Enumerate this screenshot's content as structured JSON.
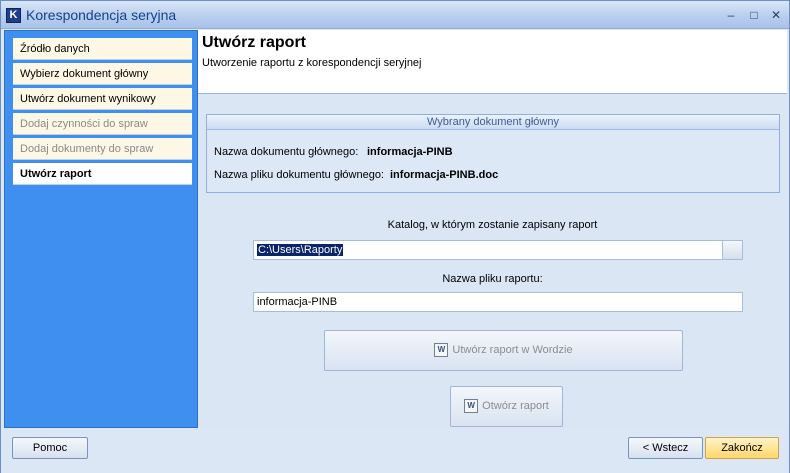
{
  "window": {
    "title": "Korespondencja seryjna",
    "icon_letter": "K",
    "minimize_glyph": "–",
    "maximize_glyph": "□",
    "close_glyph": "✕"
  },
  "sidebar": {
    "items": [
      {
        "label": "Źródło danych",
        "state": "normal"
      },
      {
        "label": "Wybierz dokument główny",
        "state": "normal"
      },
      {
        "label": "Utwórz dokument wynikowy",
        "state": "normal"
      },
      {
        "label": "Dodaj czynności do spraw",
        "state": "disabled"
      },
      {
        "label": "Dodaj dokumenty do spraw",
        "state": "disabled"
      },
      {
        "label": "Utwórz raport",
        "state": "active"
      }
    ]
  },
  "header": {
    "title": "Utwórz raport",
    "subtitle": "Utworzenie raportu z korespondencji seryjnej"
  },
  "group": {
    "title": "Wybrany dokument główny",
    "doc_name_label": "Nazwa dokumentu głównego:",
    "doc_name_value": "informacja-PINB",
    "file_name_label": "Nazwa pliku dokumentu głównego:",
    "file_name_value": "informacja-PINB.doc"
  },
  "form": {
    "catalog_label": "Katalog, w którym zostanie zapisany raport",
    "catalog_value": "C:\\Users\\Raporty",
    "report_name_label": "Nazwa pliku raportu:",
    "report_name_value": "informacja-PINB"
  },
  "actions": {
    "create_in_word": "Utwórz raport w Wordzie",
    "open_report": "Otwórz raport",
    "word_icon_glyph": "W"
  },
  "footer": {
    "help": "Pomoc",
    "back": "< Wstecz",
    "finish": "Zakończ"
  },
  "colors": {
    "sidebar": "#3e8ff0",
    "title_text": "#15428b",
    "finish_button": "#ffd76a"
  }
}
